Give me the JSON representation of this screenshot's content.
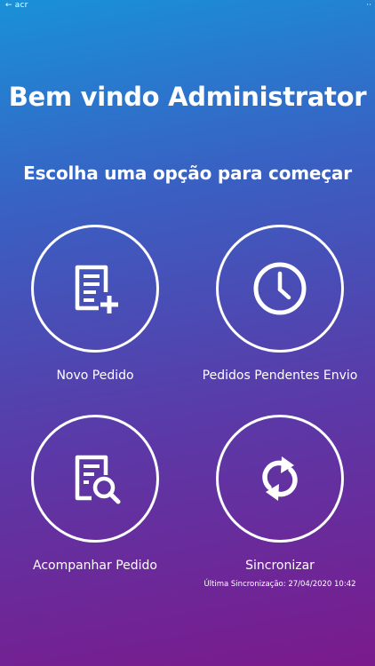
{
  "status_bar": {
    "left_text": "← acr",
    "right_text": "··"
  },
  "header": {
    "title": "Bem vindo Administrator",
    "subtitle": "Escolha uma opção para começar"
  },
  "menu": {
    "items": [
      {
        "label": "Novo Pedido",
        "icon": "document-add-icon"
      },
      {
        "label": "Pedidos Pendentes Envio",
        "icon": "clock-icon"
      },
      {
        "label": "Acompanhar Pedido",
        "icon": "document-search-icon"
      },
      {
        "label": "Sincronizar",
        "icon": "sync-icon"
      }
    ]
  },
  "sync": {
    "last_sync_label": "Última Sincronização:",
    "last_sync_value": "27/04/2020 10:42"
  },
  "colors": {
    "gradient_top": "#1991d8",
    "gradient_bottom": "#7a1a8c",
    "foreground": "#ffffff"
  }
}
